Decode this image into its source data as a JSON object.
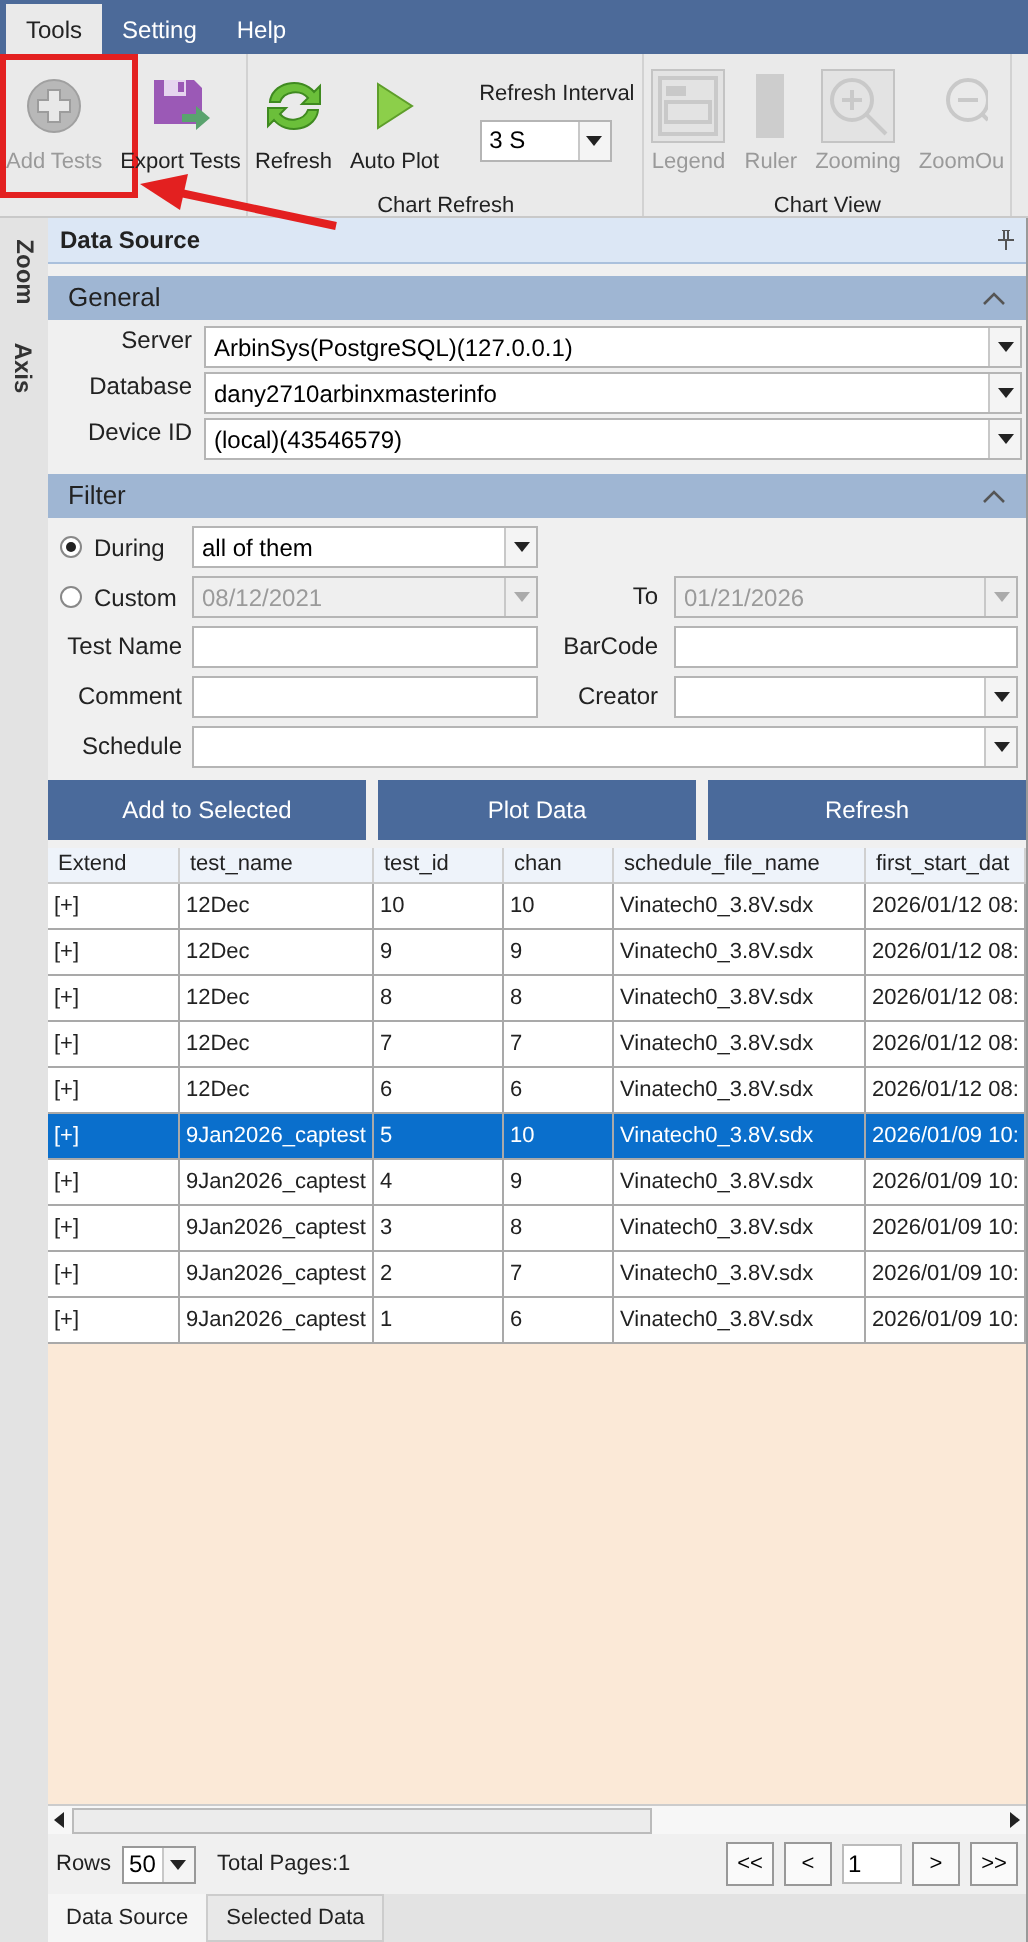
{
  "menu": [
    {
      "label": "Tools",
      "selected": true
    },
    {
      "label": "Setting",
      "selected": false
    },
    {
      "label": "Help",
      "selected": false
    }
  ],
  "ribbon": [
    {
      "items": [
        {
          "kind": "button",
          "label": "Add Tests",
          "disabled": true,
          "highlighted": true
        },
        {
          "kind": "button",
          "label": "Export Tests",
          "disabled": false,
          "highlighted": false
        }
      ]
    },
    {
      "label": "Chart Refresh",
      "items": [
        {
          "kind": "button",
          "label": "Refresh",
          "disabled": false,
          "highlighted": false
        },
        {
          "kind": "button",
          "label": "Auto Plot",
          "disabled": false,
          "highlighted": false
        },
        {
          "kind": "interval",
          "label": "Refresh Interval",
          "value": "3 S"
        }
      ]
    },
    {
      "label": "Chart View",
      "items": [
        {
          "kind": "button",
          "label": "Legend",
          "disabled": true,
          "highlighted": false
        },
        {
          "kind": "button",
          "label": "Ruler",
          "disabled": true,
          "highlighted": false
        },
        {
          "kind": "button",
          "label": "Zooming",
          "disabled": true,
          "highlighted": false
        },
        {
          "kind": "button",
          "label": "ZoomOu",
          "disabled": true,
          "highlighted": false
        }
      ]
    }
  ],
  "side_tabs": [
    "Zoom",
    "Axis"
  ],
  "panel": {
    "title": "Data Source"
  },
  "general": {
    "title": "General",
    "fields": [
      {
        "label": "Server",
        "value": "ArbinSys(PostgreSQL)(127.0.0.1)"
      },
      {
        "label": "Database",
        "value": "dany2710arbinxmasterinfo"
      },
      {
        "label": "Device ID",
        "value": "(local)(43546579)"
      }
    ]
  },
  "filter": {
    "title": "Filter",
    "during": {
      "label": "During",
      "selected": true,
      "value": "all of them"
    },
    "custom": {
      "label": "Custom",
      "selected": false,
      "from": "08/12/2021",
      "to_label": "To",
      "to": "01/21/2026"
    },
    "test_name": {
      "label": "Test Name"
    },
    "barcode": {
      "label": "BarCode"
    },
    "comment": {
      "label": "Comment"
    },
    "creator": {
      "label": "Creator"
    },
    "schedule": {
      "label": "Schedule"
    }
  },
  "actions": [
    "Add to Selected",
    "Plot Data",
    "Refresh"
  ],
  "table": {
    "columns": [
      "Extend",
      "test_name",
      "test_id",
      "chan",
      "schedule_file_name",
      "first_start_dat"
    ],
    "rows": [
      {
        "selected": false,
        "cells": [
          "[+]",
          "12Dec",
          "10",
          "10",
          "Vinatech0_3.8V.sdx",
          "2026/01/12 08:"
        ]
      },
      {
        "selected": false,
        "cells": [
          "[+]",
          "12Dec",
          "9",
          "9",
          "Vinatech0_3.8V.sdx",
          "2026/01/12 08:"
        ]
      },
      {
        "selected": false,
        "cells": [
          "[+]",
          "12Dec",
          "8",
          "8",
          "Vinatech0_3.8V.sdx",
          "2026/01/12 08:"
        ]
      },
      {
        "selected": false,
        "cells": [
          "[+]",
          "12Dec",
          "7",
          "7",
          "Vinatech0_3.8V.sdx",
          "2026/01/12 08:"
        ]
      },
      {
        "selected": false,
        "cells": [
          "[+]",
          "12Dec",
          "6",
          "6",
          "Vinatech0_3.8V.sdx",
          "2026/01/12 08:"
        ]
      },
      {
        "selected": true,
        "cells": [
          "[+]",
          "9Jan2026_captest",
          "5",
          "10",
          "Vinatech0_3.8V.sdx",
          "2026/01/09 10:"
        ]
      },
      {
        "selected": false,
        "cells": [
          "[+]",
          "9Jan2026_captest",
          "4",
          "9",
          "Vinatech0_3.8V.sdx",
          "2026/01/09 10:"
        ]
      },
      {
        "selected": false,
        "cells": [
          "[+]",
          "9Jan2026_captest",
          "3",
          "8",
          "Vinatech0_3.8V.sdx",
          "2026/01/09 10:"
        ]
      },
      {
        "selected": false,
        "cells": [
          "[+]",
          "9Jan2026_captest",
          "2",
          "7",
          "Vinatech0_3.8V.sdx",
          "2026/01/09 10:"
        ]
      },
      {
        "selected": false,
        "cells": [
          "[+]",
          "9Jan2026_captest",
          "1",
          "6",
          "Vinatech0_3.8V.sdx",
          "2026/01/09 10:"
        ]
      }
    ]
  },
  "pager": {
    "rows_label": "Rows",
    "rows_value": "50",
    "total": "Total Pages:1",
    "back": [
      "<<",
      "<"
    ],
    "page": "1",
    "forward": [
      ">",
      ">>"
    ]
  },
  "bottom_tabs": [
    {
      "label": "Data Source",
      "selected": true
    },
    {
      "label": "Selected Data",
      "selected": false
    }
  ]
}
